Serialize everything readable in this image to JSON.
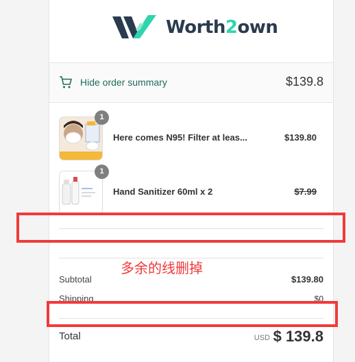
{
  "brand": {
    "name_part1": "Worth",
    "name_hl": "2",
    "name_part2": "own"
  },
  "summary": {
    "toggle_label": "Hide order summary",
    "toggle_total": "$139.8"
  },
  "items": [
    {
      "qty": "1",
      "name": "Here comes N95! Filter at leas...",
      "price": "$139.80",
      "thumb_icon": "n95-mask-product-image"
    },
    {
      "qty": "1",
      "name": "Hand Sanitizer 60ml x 2",
      "price": "$7.99",
      "price_strikethrough": true,
      "thumb_icon": "hand-sanitizer-product-image"
    }
  ],
  "annotation": {
    "text": "多余的线删掉"
  },
  "totals": {
    "subtotal_label": "Subtotal",
    "subtotal_value": "$139.80",
    "shipping_label": "Shipping",
    "shipping_value": "$0",
    "total_label": "Total",
    "total_currency": "USD",
    "total_value": "$ 139.8"
  },
  "colors": {
    "accent": "#2fd4ae",
    "brand_dark": "#2b3b4f",
    "annotation_red": "#f03a3a",
    "link_green": "#1f6b5a"
  }
}
